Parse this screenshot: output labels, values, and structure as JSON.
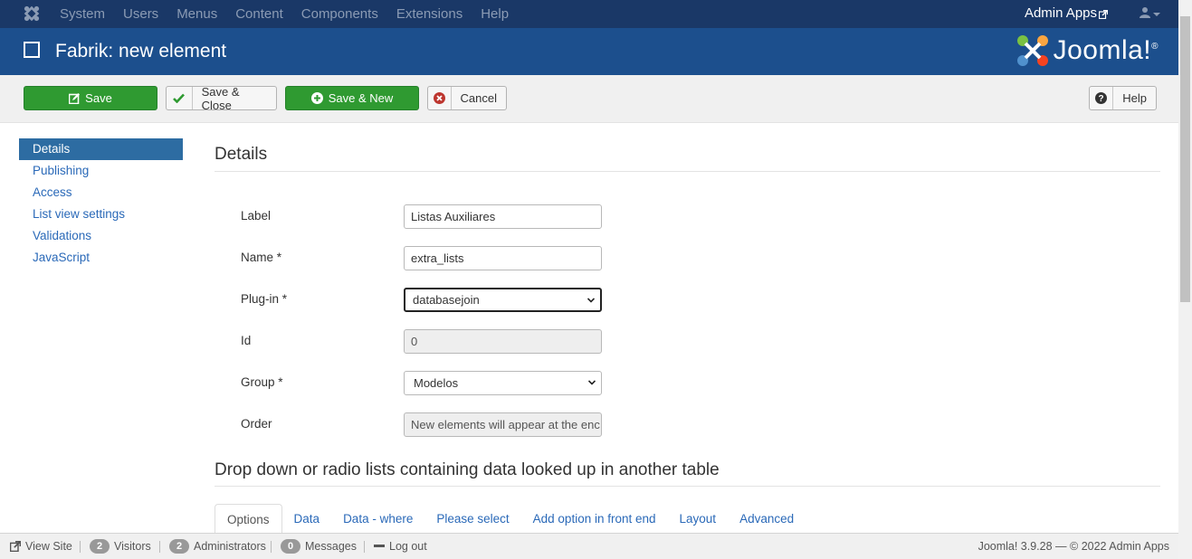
{
  "topnav": {
    "menu": [
      "System",
      "Users",
      "Menus",
      "Content",
      "Components",
      "Extensions",
      "Help"
    ],
    "site_name": "Admin Apps"
  },
  "header": {
    "title": "Fabrik: new element",
    "brand": "Joomla!",
    "brand_reg": "®"
  },
  "toolbar": {
    "save": "Save",
    "save_close": "Save & Close",
    "save_new": "Save & New",
    "cancel": "Cancel",
    "help": "Help"
  },
  "sidebar": {
    "items": [
      {
        "label": "Details",
        "active": true
      },
      {
        "label": "Publishing"
      },
      {
        "label": "Access"
      },
      {
        "label": "List view settings"
      },
      {
        "label": "Validations"
      },
      {
        "label": "JavaScript"
      }
    ]
  },
  "details": {
    "heading": "Details",
    "label": {
      "label": "Label",
      "value": "Listas Auxiliares"
    },
    "name": {
      "label": "Name *",
      "value": "extra_lists"
    },
    "plugin": {
      "label": "Plug-in *",
      "value": "databasejoin"
    },
    "id": {
      "label": "Id",
      "value": "0"
    },
    "group": {
      "label": "Group *",
      "value": "Modelos"
    },
    "order": {
      "label": "Order",
      "value": "New elements will appear at the enc"
    }
  },
  "plugin_section": {
    "heading": "Drop down or radio lists containing data looked up in another table",
    "tabs": [
      "Options",
      "Data",
      "Data - where",
      "Please select",
      "Add option in front end",
      "Layout",
      "Advanced"
    ]
  },
  "status": {
    "view_site": "View Site",
    "visitors_count": "2",
    "visitors": "Visitors",
    "admins_count": "2",
    "admins": "Administrators",
    "messages_count": "0",
    "messages": "Messages",
    "logout": "Log out",
    "version": "Joomla! 3.9.28",
    "copyright": "— © 2022 Admin Apps"
  },
  "colors": {
    "topnav_bg": "#1a3867",
    "header_bg": "#1c4f8d",
    "green_button": "#2f9a31",
    "active_nav": "#2d6ca2",
    "link": "#2a69b8"
  }
}
